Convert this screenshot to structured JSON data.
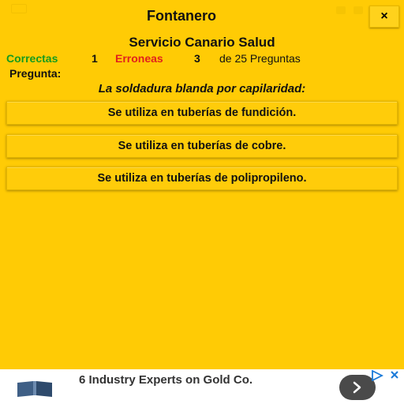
{
  "header": {
    "title": "Fontanero",
    "close_label": "×"
  },
  "subtitle": "Servicio Canario Salud",
  "score": {
    "correct_label": "Correctas",
    "correct_value": "1",
    "wrong_label": "Erroneas",
    "wrong_value": "3",
    "total_text": "de 25 Preguntas",
    "colors": {
      "correct": "#159b1e",
      "wrong": "#e2211c"
    }
  },
  "question": {
    "label": "Pregunta:",
    "text": "La soldadura blanda por capilaridad:"
  },
  "answers": [
    {
      "label": "Se utiliza en tuberías de fundición."
    },
    {
      "label": "Se utiliza en tuberías de cobre."
    },
    {
      "label": "Se utiliza en tuberías de polipropileno."
    }
  ],
  "ad": {
    "headline": "6 Industry Experts on Gold Co.",
    "go_icon": "chevron-right-icon",
    "adchoices_icon": "adchoices-icon",
    "close_icon": "close-icon"
  },
  "theme": {
    "background": "#ffcb05",
    "button_border": "#e4b600"
  }
}
